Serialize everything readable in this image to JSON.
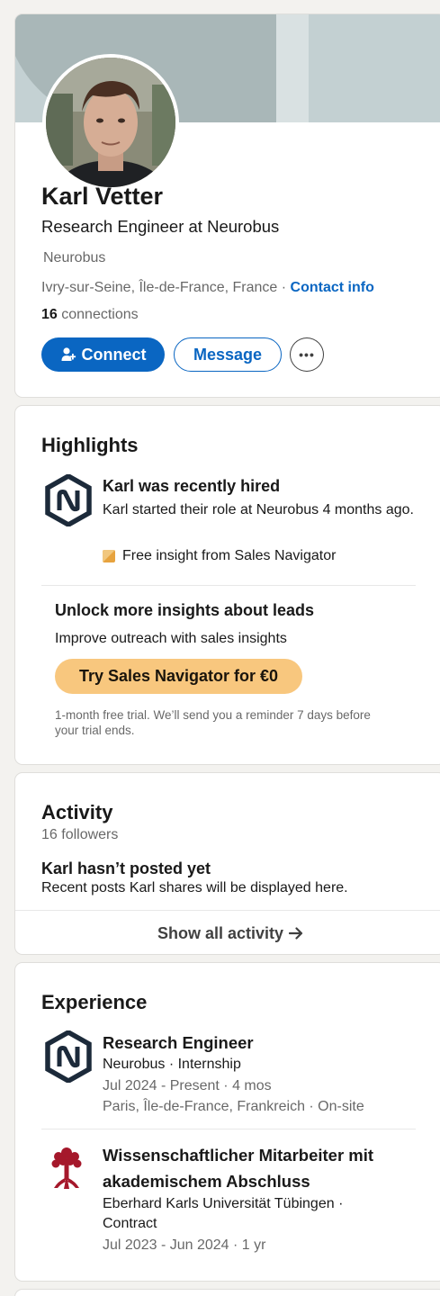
{
  "profile": {
    "name": "Karl Vetter",
    "headline": "Research Engineer at Neurobus",
    "company": "Neurobus",
    "location": "Ivry-sur-Seine, Île-de-France, France",
    "separator": " · ",
    "contact_info_label": "Contact info",
    "connections_count": "16",
    "connections_label": " connections",
    "connect_label": "Connect",
    "message_label": "Message",
    "more_label": "•••"
  },
  "highlights": {
    "title": "Highlights",
    "item_title": "Karl was recently hired",
    "item_desc": "Karl started their role at Neurobus 4 months ago.",
    "insight_label": "Free insight from Sales Navigator",
    "unlock_title": "Unlock more insights about leads",
    "unlock_sub": "Improve outreach with sales insights",
    "cta_label": "Try Sales Navigator for €0",
    "trial_note": "1-month free trial. We’ll send you a reminder 7 days before your trial ends."
  },
  "activity": {
    "title": "Activity",
    "followers": "16 followers",
    "empty_title": "Karl hasn’t posted yet",
    "empty_desc": "Recent posts Karl shares will be displayed here.",
    "show_all_label": "Show all activity",
    "arrow_icon": "arrow-right-icon"
  },
  "experience": {
    "title": "Experience",
    "items": [
      {
        "title": "Research Engineer",
        "company_line": "Neurobus · Internship",
        "dates": "Jul 2024 - Present · 4 mos",
        "location": "Paris, Île-de-France, Frankreich · On-site",
        "logo_icon": "neurobus-logo-icon"
      },
      {
        "title": "Wissenschaftlicher Mitarbeiter mit akademischem Abschluss",
        "company_line": "Eberhard Karls Universität Tübingen · Contract",
        "dates": "Jul 2023 - Jun 2024 · 1 yr",
        "logo_icon": "tuebingen-tree-logo-icon"
      }
    ]
  },
  "colors": {
    "accent": "#0a66c2",
    "sales_cta": "#f8c77e",
    "neurobus_logo": "#1c2a3a",
    "tuebingen_logo": "#a5182b"
  }
}
